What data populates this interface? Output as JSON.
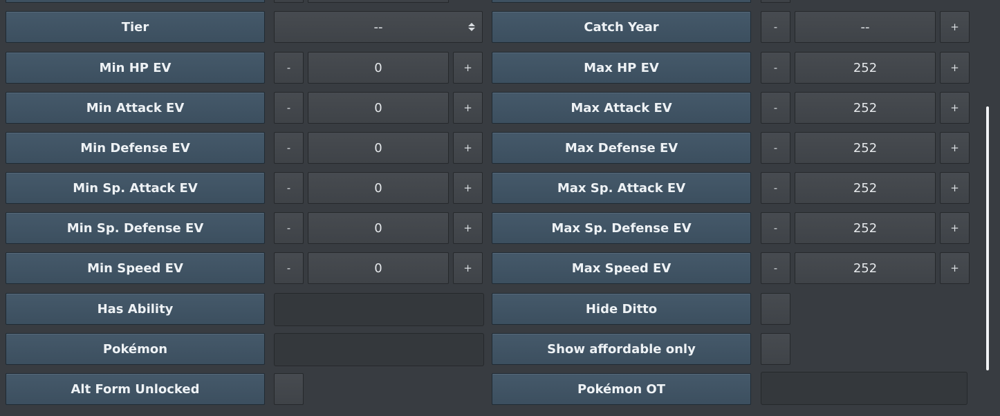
{
  "tier": {
    "label": "Tier",
    "value": "--"
  },
  "catch_year": {
    "label": "Catch Year",
    "value": "--",
    "minus": "-",
    "plus": "+"
  },
  "ev_rows": [
    {
      "min_label": "Min HP EV",
      "min_value": "0",
      "max_label": "Max HP EV",
      "max_value": "252"
    },
    {
      "min_label": "Min Attack EV",
      "min_value": "0",
      "max_label": "Max Attack EV",
      "max_value": "252"
    },
    {
      "min_label": "Min Defense EV",
      "min_value": "0",
      "max_label": "Max Defense EV",
      "max_value": "252"
    },
    {
      "min_label": "Min Sp. Attack EV",
      "min_value": "0",
      "max_label": "Max Sp. Attack EV",
      "max_value": "252"
    },
    {
      "min_label": "Min Sp. Defense EV",
      "min_value": "0",
      "max_label": "Max Sp. Defense EV",
      "max_value": "252"
    },
    {
      "min_label": "Min Speed EV",
      "min_value": "0",
      "max_label": "Max Speed EV",
      "max_value": "252"
    }
  ],
  "stepper": {
    "minus": "-",
    "plus": "+"
  },
  "has_ability": {
    "label": "Has Ability",
    "value": ""
  },
  "hide_ditto": {
    "label": "Hide Ditto",
    "checked": false
  },
  "pokemon": {
    "label": "Pokémon",
    "value": ""
  },
  "show_affordable": {
    "label": "Show affordable only",
    "checked": false
  },
  "alt_form": {
    "label": "Alt Form Unlocked",
    "checked": false
  },
  "pokemon_ot": {
    "label": "Pokémon OT",
    "value": ""
  }
}
